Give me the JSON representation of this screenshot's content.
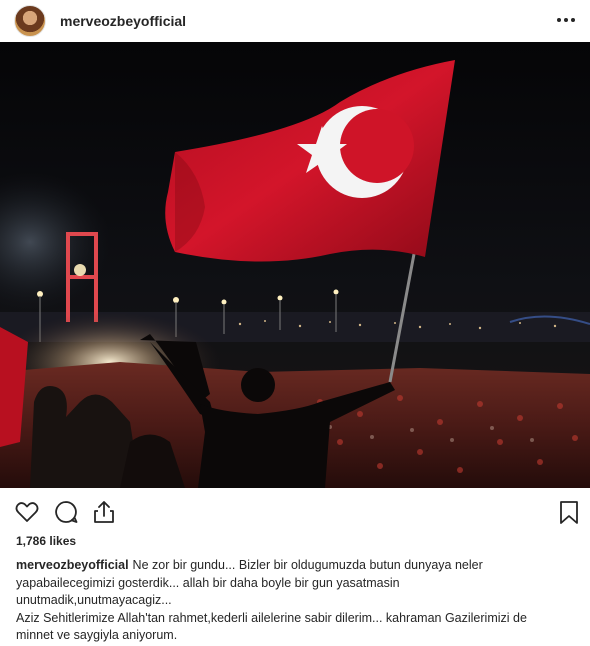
{
  "post": {
    "username": "merveozbeyofficial",
    "avatar_icon": "profile-avatar",
    "more_icon": "more-horizontal-icon",
    "likes": "1,786 likes",
    "caption": {
      "username": "merveozbeyofficial",
      "lines": [
        "Ne zor bir gundu... Bizler bir oldugumuzda butun dunyaya neler",
        "yapabailecegimizi gosterdik... allah bir daha boyle bir gun yasatmasin",
        "unutmadik,unutmayacagiz...",
        "Aziz Sehitlerimize Allah'tan rahmet,kederli ailelerine sabir dilerim... kahraman Gazilerimizi de",
        "minnet ve saygiyla aniyorum."
      ]
    }
  },
  "actions": {
    "like_icon": "heart-outline-icon",
    "comment_icon": "comment-icon",
    "share_icon": "share-icon",
    "save_icon": "bookmark-icon"
  },
  "colors": {
    "text": "#262626",
    "flag_red": "#c8102e",
    "background": "#ffffff"
  }
}
